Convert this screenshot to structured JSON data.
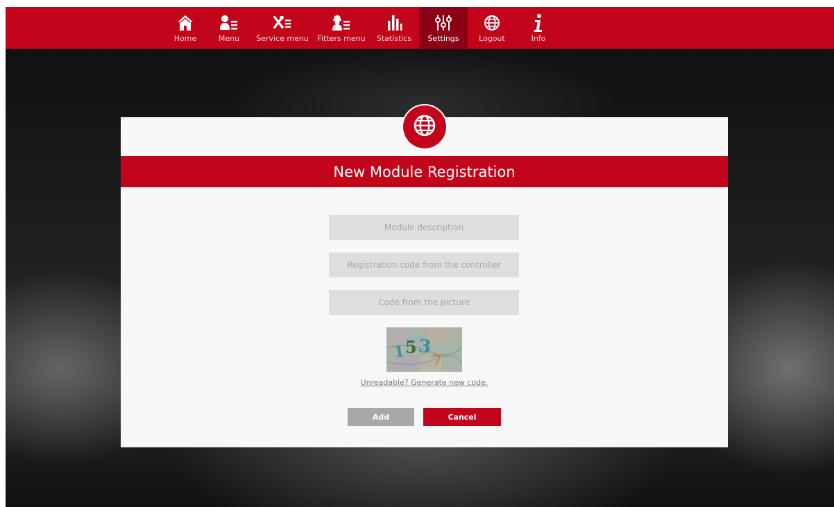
{
  "colors": {
    "brand_red": "#c3051c",
    "active_nav": "#8c0116",
    "field_bg": "#dedede",
    "add_button": "#a8a8a8"
  },
  "nav": {
    "items": [
      {
        "label": "Home",
        "icon": "home-icon",
        "active": false
      },
      {
        "label": "Menu",
        "icon": "user-menu-icon",
        "active": false
      },
      {
        "label": "Service menu",
        "icon": "tools-menu-icon",
        "active": false
      },
      {
        "label": "Fitters menu",
        "icon": "fitter-menu-icon",
        "active": false
      },
      {
        "label": "Statistics",
        "icon": "bar-chart-icon",
        "active": false
      },
      {
        "label": "Settings",
        "icon": "sliders-icon",
        "active": true
      },
      {
        "label": "Logout",
        "icon": "globe-icon",
        "active": false
      },
      {
        "label": "Info",
        "icon": "info-icon",
        "active": false
      }
    ]
  },
  "modal": {
    "badge_icon": "globe-icon",
    "title": "New Module Registration",
    "fields": {
      "description_placeholder": "Module description",
      "registration_placeholder": "Registration code from the controller",
      "captcha_placeholder": "Code from the picture"
    },
    "captcha_code": "1537",
    "regenerate_link": "Unreadable? Generate new code.",
    "add_label": "Add",
    "cancel_label": "Cancel"
  }
}
